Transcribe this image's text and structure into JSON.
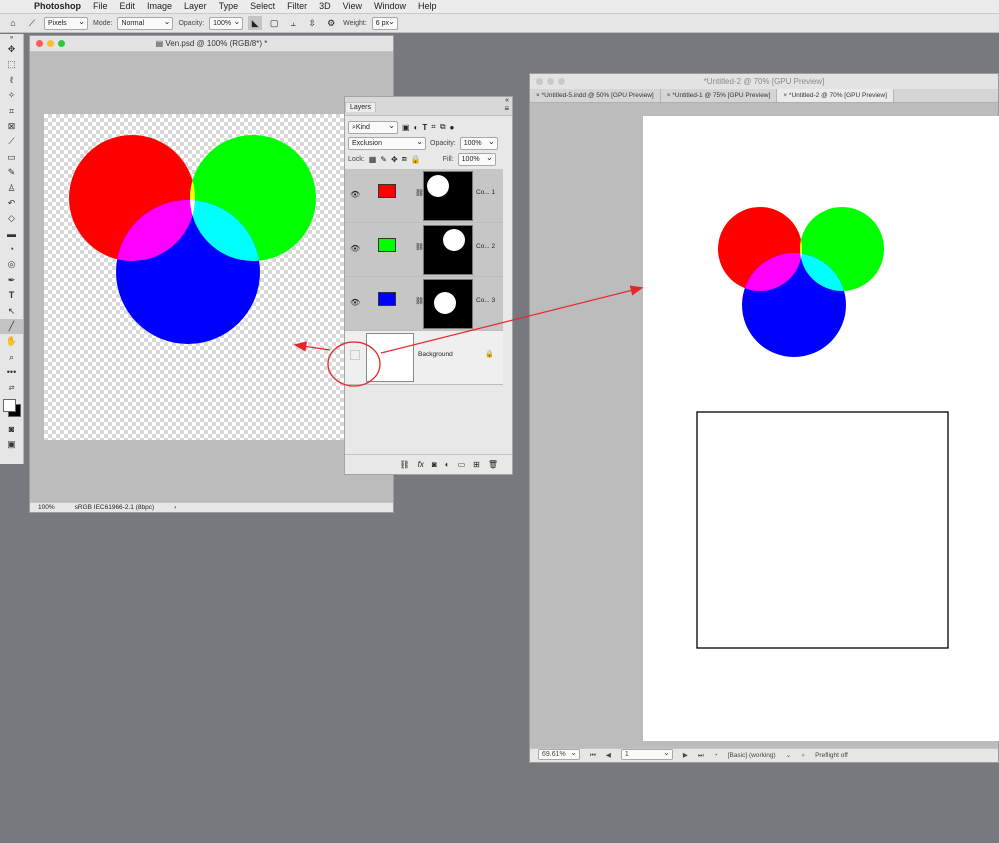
{
  "menubar": {
    "app": "Photoshop",
    "items": [
      "File",
      "Edit",
      "Image",
      "Layer",
      "Type",
      "Select",
      "Filter",
      "3D",
      "View",
      "Window",
      "Help"
    ]
  },
  "options": {
    "pixels": "Pixels",
    "mode_label": "Mode:",
    "mode_value": "Normal",
    "opacity_label": "Opacity:",
    "opacity_value": "100%",
    "weight_label": "Weight:",
    "weight_value": "6 px"
  },
  "win1": {
    "title": "Ven.psd @ 100% (RGB/8*) *",
    "zoom": "100%",
    "profile": "sRGB IEC61966-2.1 (8bpc)"
  },
  "layers_panel": {
    "tab": "Layers",
    "filter": "Kind",
    "blend": "Exclusion",
    "opacity_label": "Opacity:",
    "opacity_value": "100%",
    "lock_label": "Lock:",
    "fill_label": "Fill:",
    "fill_value": "100%",
    "layers": [
      {
        "name": "Co... 1",
        "color": "#ff0000"
      },
      {
        "name": "Co... 2",
        "color": "#00ff00"
      },
      {
        "name": "Co... 3",
        "color": "#0000ff"
      },
      {
        "name": "Background",
        "color": "#ffffff"
      }
    ]
  },
  "win2": {
    "title": "*Untitled-2 @ 70% [GPU Preview]",
    "tabs": [
      "*Untitled-5.indd @ 50% [GPU Preview]",
      "*Untitled-1 @ 75% [GPU Preview]",
      "*Untitled-2 @ 70% [GPU Preview]"
    ],
    "zoom": "69.61%",
    "page": "1",
    "style": "[Basic] (working)",
    "preflight": "Preflight off"
  },
  "colors": {
    "red": "#ff0000",
    "green": "#00ff00",
    "blue": "#0000ff",
    "annotation": "#e8262a"
  }
}
